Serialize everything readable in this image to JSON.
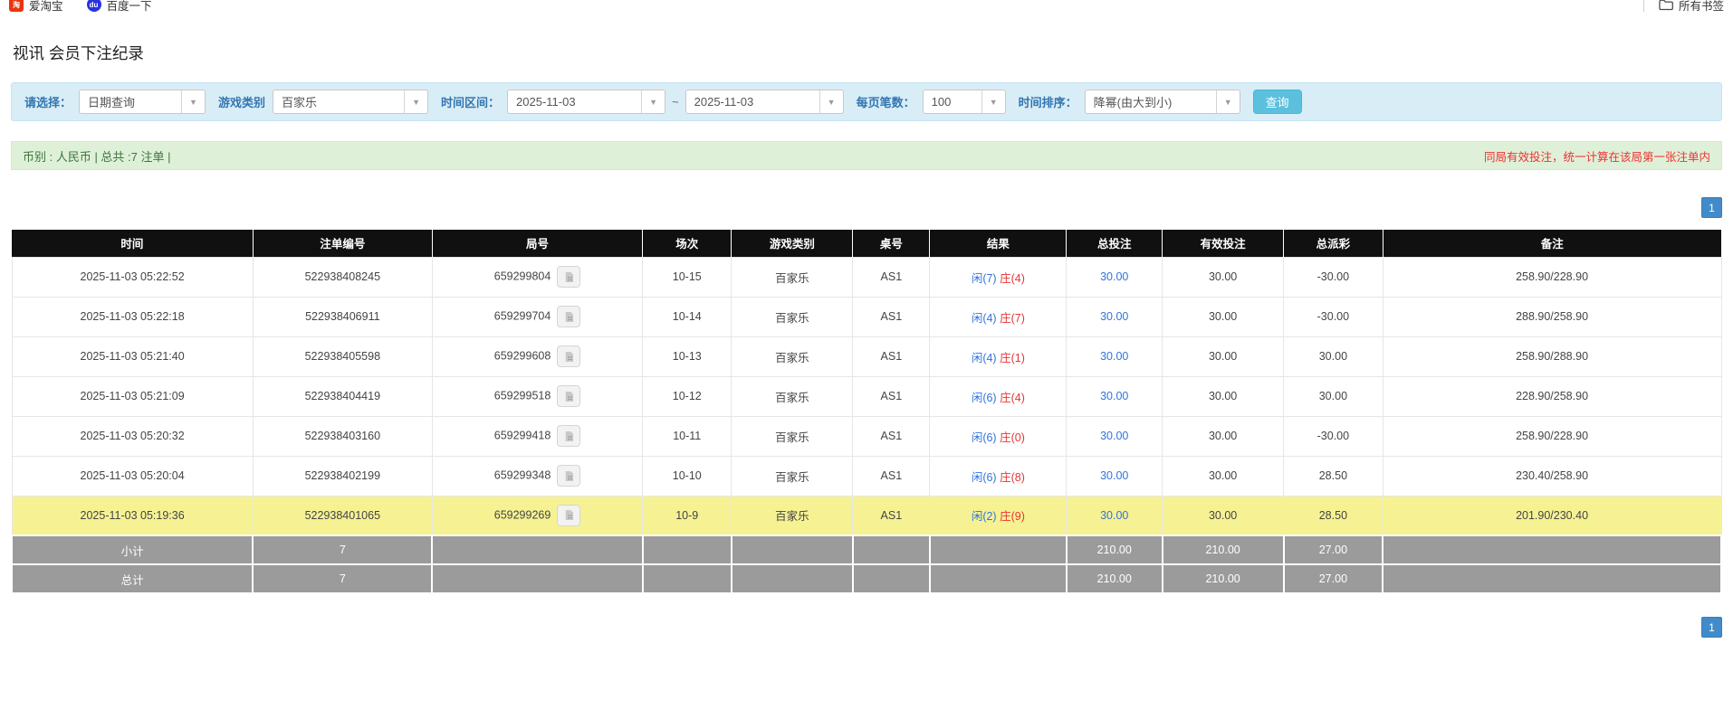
{
  "bookmarks_bar": {
    "items": [
      {
        "label": "爱淘宝",
        "icon": "taobao-icon"
      },
      {
        "label": "百度一下",
        "icon": "baidu-icon"
      }
    ],
    "all_bookmarks": "所有书签"
  },
  "page": {
    "title": "视讯 会员下注纪录"
  },
  "filters": {
    "select_label": "请选择：",
    "select_value": "日期查询",
    "game_type_label": "游戏类别",
    "game_type_value": "百家乐",
    "time_range_label": "时间区间：",
    "date_from": "2025-11-03",
    "tilde": "~",
    "date_to": "2025-11-03",
    "per_page_label": "每页笔数：",
    "per_page_value": "100",
    "sort_label": "时间排序：",
    "sort_value": "降幂(由大到小)",
    "search_button": "查询"
  },
  "summary_bar": {
    "left_text": "币别 : 人民币 | 总共 :7 注单 |",
    "right_note": "同局有效投注，统一计算在该局第一张注单内"
  },
  "pagination": {
    "page": "1"
  },
  "table": {
    "headers": [
      "时间",
      "注单编号",
      "局号",
      "场次",
      "游戏类别",
      "桌号",
      "结果",
      "总投注",
      "有效投注",
      "总派彩",
      "备注"
    ],
    "rows": [
      {
        "time": "2025-11-03 05:22:52",
        "bet_id": "522938408245",
        "round_id": "659299804",
        "session": "10-15",
        "game": "百家乐",
        "table_no": "AS1",
        "result_player": "闲(7)",
        "result_banker": "庄(4)",
        "total_bet": "30.00",
        "valid_bet": "30.00",
        "payout": "-30.00",
        "note": "258.90/228.90",
        "highlight": false
      },
      {
        "time": "2025-11-03 05:22:18",
        "bet_id": "522938406911",
        "round_id": "659299704",
        "session": "10-14",
        "game": "百家乐",
        "table_no": "AS1",
        "result_player": "闲(4)",
        "result_banker": "庄(7)",
        "total_bet": "30.00",
        "valid_bet": "30.00",
        "payout": "-30.00",
        "note": "288.90/258.90",
        "highlight": false
      },
      {
        "time": "2025-11-03 05:21:40",
        "bet_id": "522938405598",
        "round_id": "659299608",
        "session": "10-13",
        "game": "百家乐",
        "table_no": "AS1",
        "result_player": "闲(4)",
        "result_banker": "庄(1)",
        "total_bet": "30.00",
        "valid_bet": "30.00",
        "payout": "30.00",
        "note": "258.90/288.90",
        "highlight": false
      },
      {
        "time": "2025-11-03 05:21:09",
        "bet_id": "522938404419",
        "round_id": "659299518",
        "session": "10-12",
        "game": "百家乐",
        "table_no": "AS1",
        "result_player": "闲(6)",
        "result_banker": "庄(4)",
        "total_bet": "30.00",
        "valid_bet": "30.00",
        "payout": "30.00",
        "note": "228.90/258.90",
        "highlight": false
      },
      {
        "time": "2025-11-03 05:20:32",
        "bet_id": "522938403160",
        "round_id": "659299418",
        "session": "10-11",
        "game": "百家乐",
        "table_no": "AS1",
        "result_player": "闲(6)",
        "result_banker": "庄(0)",
        "total_bet": "30.00",
        "valid_bet": "30.00",
        "payout": "-30.00",
        "note": "258.90/228.90",
        "highlight": false
      },
      {
        "time": "2025-11-03 05:20:04",
        "bet_id": "522938402199",
        "round_id": "659299348",
        "session": "10-10",
        "game": "百家乐",
        "table_no": "AS1",
        "result_player": "闲(6)",
        "result_banker": "庄(8)",
        "total_bet": "30.00",
        "valid_bet": "30.00",
        "payout": "28.50",
        "note": "230.40/258.90",
        "highlight": false
      },
      {
        "time": "2025-11-03 05:19:36",
        "bet_id": "522938401065",
        "round_id": "659299269",
        "session": "10-9",
        "game": "百家乐",
        "table_no": "AS1",
        "result_player": "闲(2)",
        "result_banker": "庄(9)",
        "total_bet": "30.00",
        "valid_bet": "30.00",
        "payout": "28.50",
        "note": "201.90/230.40",
        "highlight": true
      }
    ],
    "subtotal": {
      "label": "小计",
      "count": "7",
      "total_bet": "210.00",
      "valid_bet": "210.00",
      "payout": "27.00"
    },
    "total": {
      "label": "总计",
      "count": "7",
      "total_bet": "210.00",
      "valid_bet": "210.00",
      "payout": "27.00"
    }
  },
  "colors": {
    "link_blue": "#3273dc",
    "negative_red": "#e83333",
    "note_red": "#f03030",
    "highlight_yellow": "#f6f293",
    "header_black": "#101010",
    "subtotal_grey": "#9b9b9b",
    "filter_bar_blue": "#d9edf7",
    "summary_green": "#dff0d8",
    "query_button_blue": "#5bc0de",
    "pagination_blue": "#428bca"
  }
}
